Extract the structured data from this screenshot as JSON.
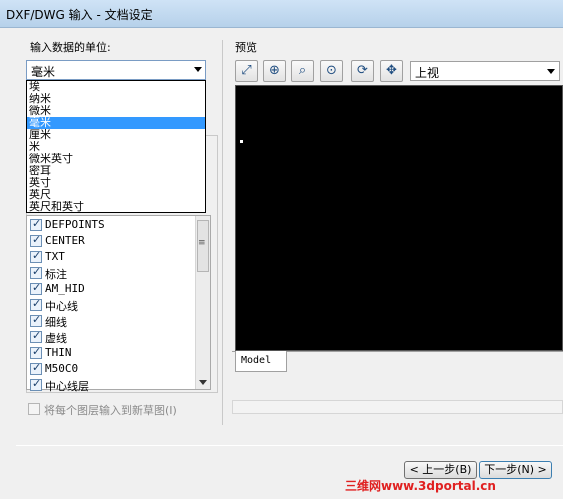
{
  "window": {
    "title": "DXF/DWG 输入 - 文档设定"
  },
  "units": {
    "label": "输入数据的单位:",
    "selected": "毫米",
    "options": [
      "埃",
      "纳米",
      "微米",
      "毫米",
      "厘米",
      "米",
      "微米英寸",
      "密耳",
      "英寸",
      "英尺",
      "英尺和英寸"
    ],
    "highlighted_index": 3
  },
  "layers": [
    {
      "name": "DEFPOINTS",
      "checked": true
    },
    {
      "name": "CENTER",
      "checked": true
    },
    {
      "name": "TXT",
      "checked": true
    },
    {
      "name": "标注",
      "checked": true
    },
    {
      "name": "AM_HID",
      "checked": true
    },
    {
      "name": "中心线",
      "checked": true
    },
    {
      "name": "细线",
      "checked": true
    },
    {
      "name": "虚线",
      "checked": true
    },
    {
      "name": "THIN",
      "checked": true
    },
    {
      "name": "M50C0",
      "checked": true
    },
    {
      "name": "中心线层",
      "checked": true
    }
  ],
  "new_sketch": {
    "label": "将每个图层输入到新草图(I)",
    "checked": false,
    "enabled": false
  },
  "preview": {
    "label": "预览",
    "toolbar_icons": [
      "zoom-to-fit-icon",
      "zoom-to-area-icon",
      "zoom-in-out-icon",
      "zoom-to-selection-icon",
      "rotate-view-icon",
      "pan-icon"
    ],
    "view": "上视",
    "tab": "Model"
  },
  "buttons": {
    "prev": "< 上一步(B)",
    "next": "下一步(N) >"
  },
  "watermark": "三维网www.3dportal.cn",
  "colors": {
    "selection": "#3399ff",
    "preview_bg": "#000000",
    "watermark": "#e02020"
  }
}
